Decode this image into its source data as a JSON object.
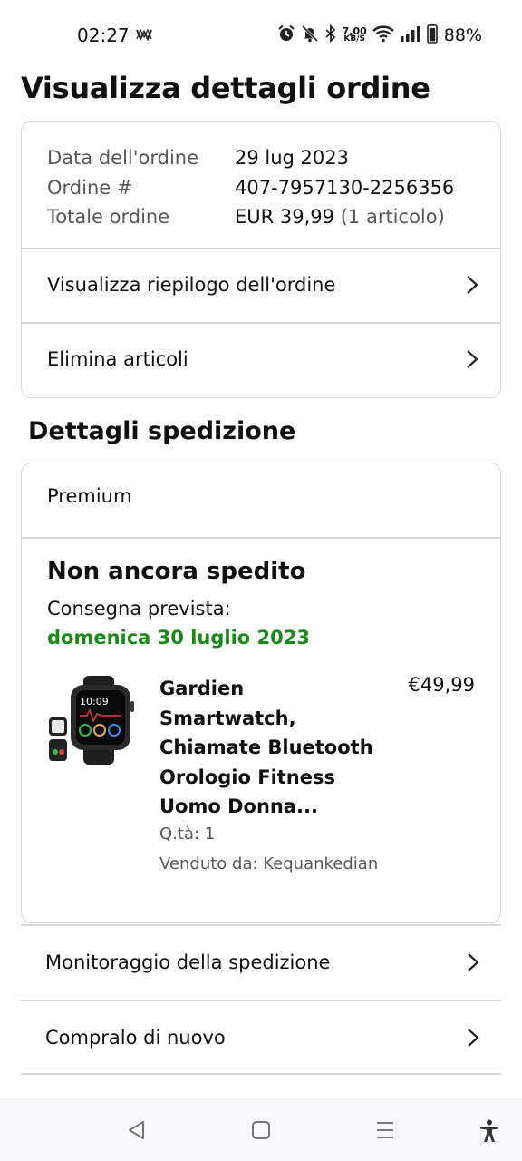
{
  "status_bar": {
    "time": "02:27",
    "speed_value": "7,00",
    "speed_unit": "KB/S",
    "battery": "88%"
  },
  "page": {
    "title": "Visualizza dettagli ordine"
  },
  "order": {
    "date_label": "Data dell'ordine",
    "date_value": "29 lug 2023",
    "number_label": "Ordine #",
    "number_value": "407-7957130-2256356",
    "total_label": "Totale ordine",
    "total_value": "EUR 39,99",
    "total_items": "(1 articolo)",
    "summary_link": "Visualizza riepilogo dell'ordine",
    "delete_link": "Elimina articoli"
  },
  "shipping": {
    "section_title": "Dettagli spedizione",
    "type": "Premium",
    "status": "Non ancora spedito",
    "delivery_label": "Consegna prevista:",
    "delivery_date": "domenica 30 luglio 2023",
    "delivery_color": "#1a8a1a",
    "product": {
      "title": "Gardien Smartwatch, Chiamate Bluetooth Orologio Fitness Uomo Donna...",
      "price": "€49,99",
      "quantity": "Q.tà: 1",
      "seller": "Venduto da: Kequankedian",
      "watch_time": "10:09"
    }
  },
  "actions": {
    "track": "Monitoraggio della spedizione",
    "buy_again": "Compralo di nuovo"
  },
  "nav": {
    "icons": [
      "back-icon",
      "home-icon",
      "recents-icon",
      "accessibility-icon"
    ]
  }
}
